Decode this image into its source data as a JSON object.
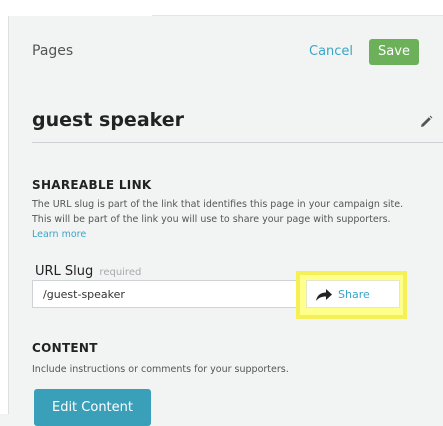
{
  "header": {
    "title": "Pages",
    "cancel_label": "Cancel",
    "save_label": "Save"
  },
  "page": {
    "name": "guest speaker"
  },
  "shareable_link": {
    "heading": "SHAREABLE LINK",
    "description_line1": "The URL slug is part of the link that identifies this page in your campaign site.",
    "description_line2": "This will be part of the link you will use to share your page with supporters.",
    "learn_more": "Learn more",
    "slug_label": "URL Slug",
    "slug_required": "required",
    "slug_value": "/guest-speaker",
    "share_label": "Share"
  },
  "content": {
    "heading": "CONTENT",
    "description": "Include instructions or comments for your supporters.",
    "edit_button": "Edit Content"
  },
  "colors": {
    "accent": "#3aa6c8",
    "save_green": "#6cb15a",
    "highlight_yellow": "#f4f055",
    "edit_button": "#3aa0ba"
  }
}
